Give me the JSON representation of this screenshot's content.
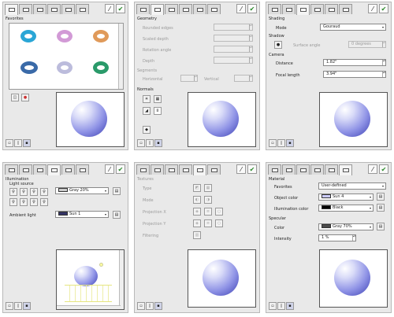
{
  "favorites": {
    "title": "Favorites"
  },
  "geometry": {
    "title": "Geometry",
    "rounded_edges": "Rounded edges",
    "scaled_depth": "Scaled depth",
    "rotation_angle": "Rotation angle",
    "depth": "Depth",
    "segments": "Segments",
    "horizontal": "Horizontal",
    "vertical": "Vertical",
    "normals": "Normals"
  },
  "shading": {
    "title": "Shading",
    "mode_label": "Mode",
    "mode_value": "Gouraud",
    "shadow": "Shadow",
    "surface_angle": "Surface angle",
    "surface_angle_value": "0 degrees",
    "camera": "Camera",
    "distance_label": "Distance",
    "distance_value": "1.82\"",
    "focal_label": "Focal length",
    "focal_value": "3.94\""
  },
  "illumination": {
    "title": "Illumination",
    "light_source": "Light source",
    "light_color": "Gray 20%",
    "ambient_label": "Ambient light",
    "ambient_color": "Sun 1"
  },
  "textures": {
    "title": "Textures",
    "type": "Type",
    "mode": "Mode",
    "projection_x": "Projection X",
    "projection_y": "Projection Y",
    "filtering": "Filtering"
  },
  "material": {
    "title": "Material",
    "favorites_label": "Favorites",
    "favorites_value": "User-defined",
    "object_color_label": "Object color",
    "object_color_value": "Sun 4",
    "illum_color_label": "Illumination color",
    "illum_color_value": "Black",
    "specular": "Specular",
    "color_label": "Color",
    "color_value": "Gray 70%",
    "intensity_label": "Intensity",
    "intensity_value": "1 %"
  },
  "colors": {
    "gray20": "#cccccc",
    "sun1": "#333366",
    "sun4": "#ccccff",
    "black": "#000000",
    "gray70": "#4c4c4c",
    "check": "#2a8a2a"
  }
}
